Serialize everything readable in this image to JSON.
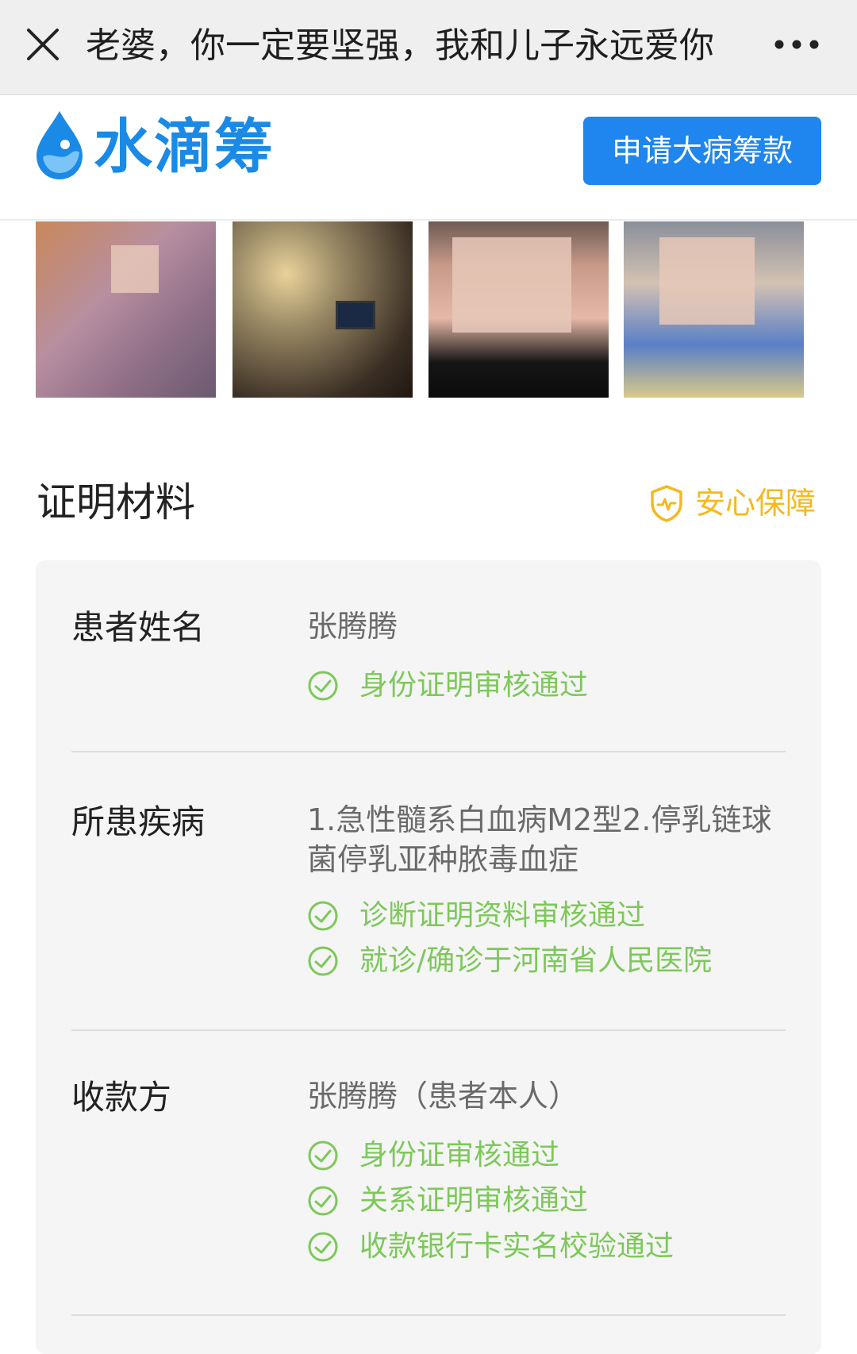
{
  "navbar": {
    "title": "老婆，你一定要坚强，我和儿子永远爱你",
    "close_icon": "close-icon",
    "more_icon": "more-dots-icon"
  },
  "brand": {
    "name": "水滴筹",
    "logo_icon": "water-drop-icon",
    "apply_label": "申请大病筹款",
    "color": "#1a8ae6",
    "button_color": "#1e86ee"
  },
  "photos": {
    "count": 4
  },
  "section": {
    "title": "证明材料",
    "guarantee_label": "安心保障",
    "guarantee_icon": "shield-heartbeat-icon",
    "guarantee_color": "#f5b81f"
  },
  "rows": [
    {
      "label": "患者姓名",
      "value": "张腾腾",
      "checks": [
        "身份证明审核通过"
      ]
    },
    {
      "label": "所患疾病",
      "value": "1.急性髓系白血病M2型2.停乳链球菌停乳亚种脓毒血症",
      "checks": [
        "诊断证明资料审核通过",
        "就诊/确诊于河南省人民医院"
      ]
    },
    {
      "label": "收款方",
      "value": "张腾腾（患者本人）",
      "checks": [
        "身份证审核通过",
        "关系证明审核通过",
        "收款银行卡实名校验通过"
      ]
    }
  ],
  "check_color": "#7dc85a"
}
